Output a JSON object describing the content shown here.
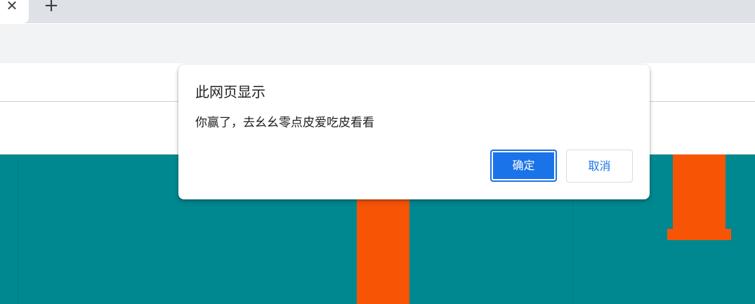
{
  "browser": {
    "tab_close_glyph": "✕",
    "new_tab_glyph": "+"
  },
  "dialog": {
    "title": "此网页显示",
    "message": "你赢了，去幺幺零点皮爱吃皮看看",
    "ok_label": "确定",
    "cancel_label": "取消"
  },
  "colors": {
    "game_background": "#008891",
    "pipe": "#f75406",
    "accent": "#1a73e8"
  },
  "icons": [
    "close-icon",
    "plus-icon"
  ]
}
